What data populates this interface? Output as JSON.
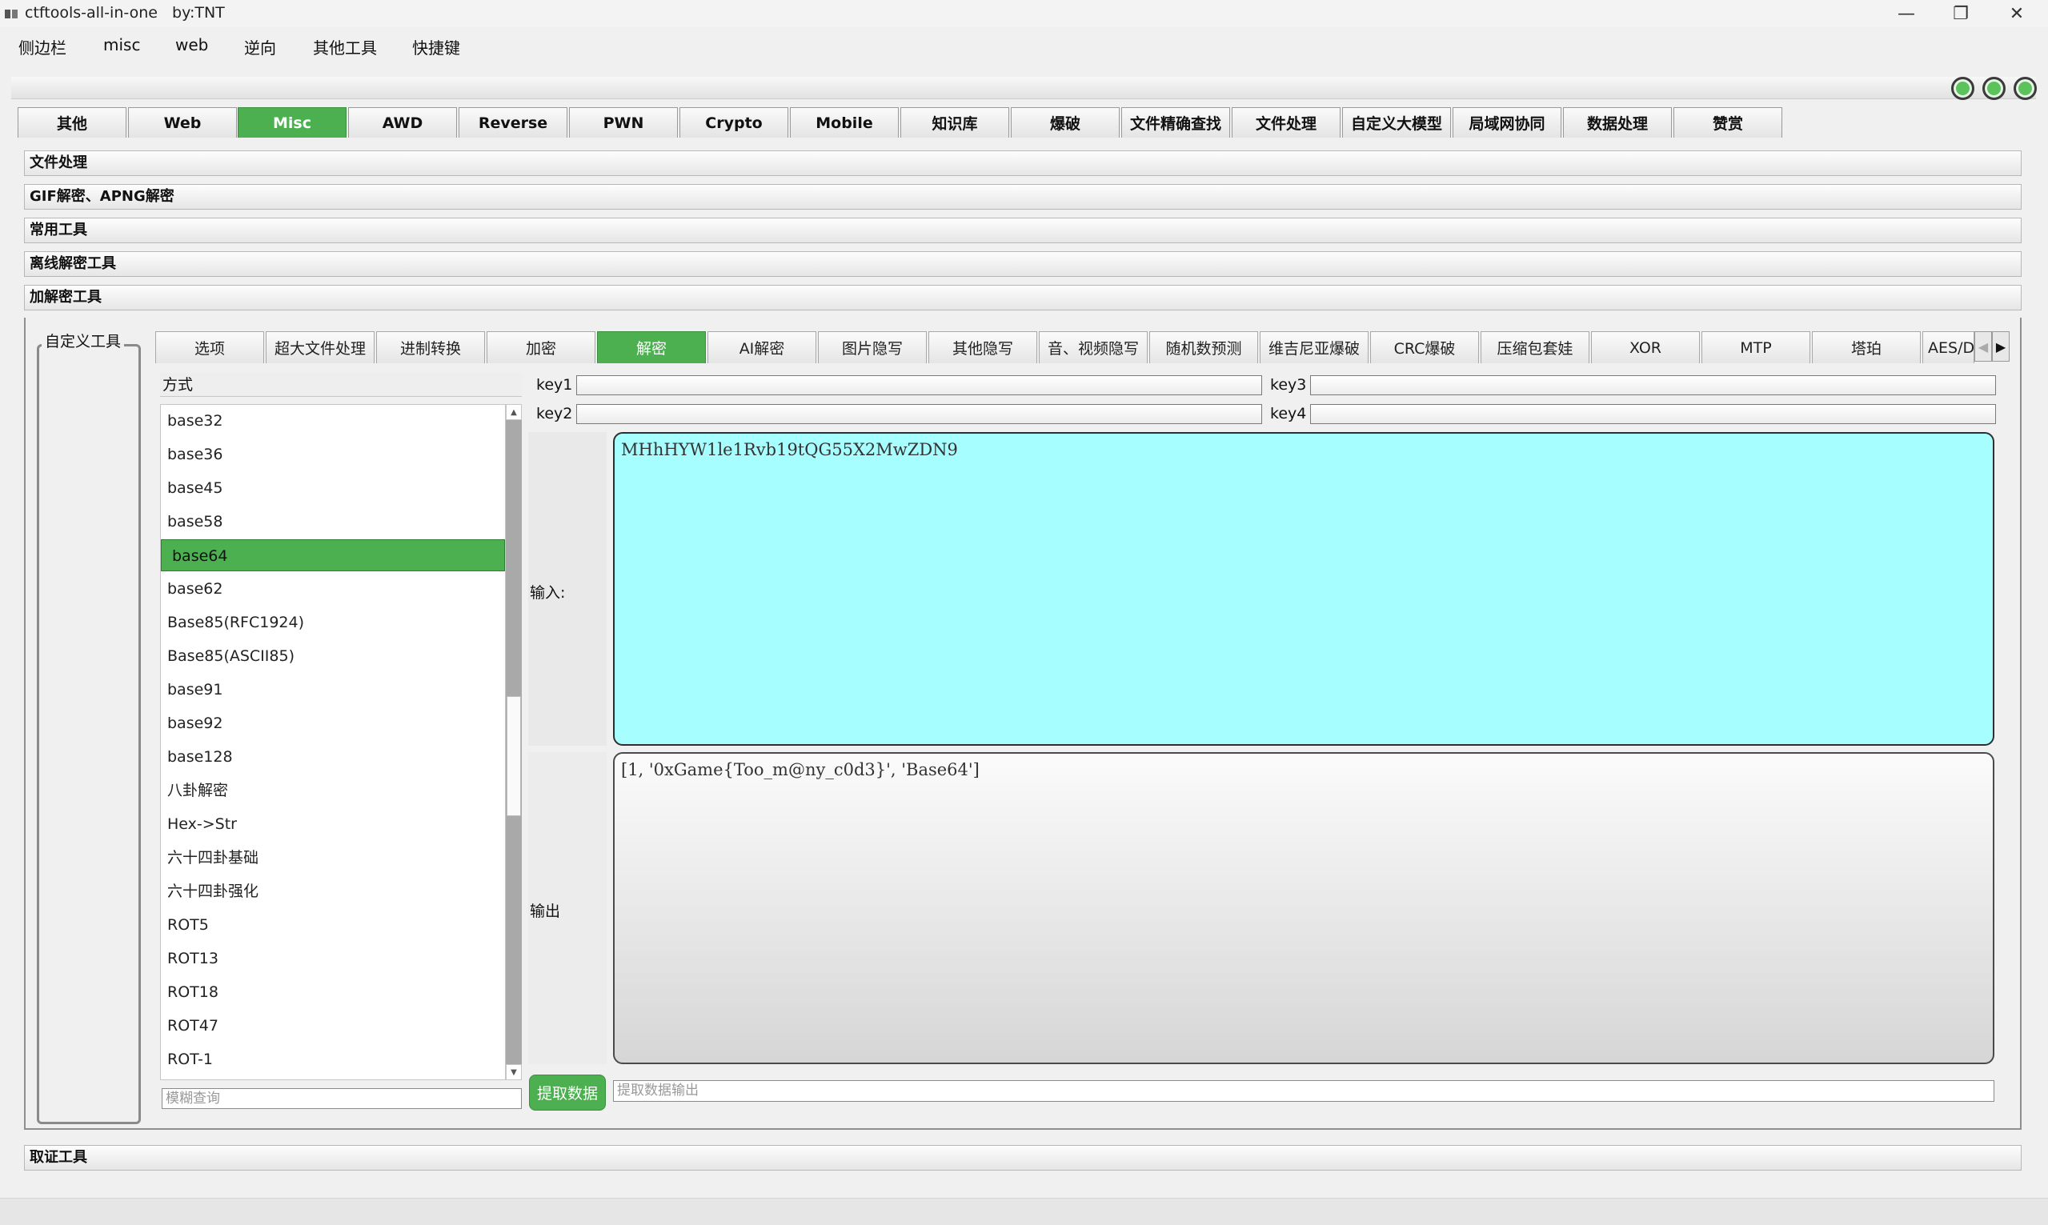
{
  "window": {
    "title": "ctftools-all-in-one   by:TNT",
    "minimize_glyph": "—",
    "restore_glyph": "❐",
    "close_glyph": "✕"
  },
  "menu": [
    "侧边栏",
    "misc",
    "web",
    "逆向",
    "其他工具",
    "快捷键"
  ],
  "main_tabs": [
    "其他",
    "Web",
    "Misc",
    "AWD",
    "Reverse",
    "PWN",
    "Crypto",
    "Mobile",
    "知识库",
    "爆破",
    "文件精确查找",
    "文件处理",
    "自定义大模型",
    "局域网协同",
    "数据处理",
    "赞赏"
  ],
  "main_tab_active": "Misc",
  "sections": [
    "文件处理",
    "GIF解密、APNG解密",
    "常用工具",
    "离线解密工具",
    "加解密工具"
  ],
  "sidebar_label": "自定义工具",
  "sub_tabs": [
    "选项",
    "超大文件处理",
    "进制转换",
    "加密",
    "解密",
    "AI解密",
    "图片隐写",
    "其他隐写",
    "音、视频隐写",
    "随机数预测",
    "维吉尼亚爆破",
    "CRC爆破",
    "压缩包套娃",
    "XOR",
    "MTP",
    "塔珀",
    "AES/D"
  ],
  "sub_tab_active": "解密",
  "method_header": "方式",
  "methods": [
    "base32",
    "base36",
    "base45",
    "base58",
    "base64",
    "base62",
    "Base85(RFC1924)",
    "Base85(ASCII85)",
    "base91",
    "base92",
    "base128",
    "八卦解密",
    "Hex->Str",
    "六十四卦基础",
    "六十四卦强化",
    "ROT5",
    "ROT13",
    "ROT18",
    "ROT47",
    "ROT-1"
  ],
  "method_selected": "base64",
  "search_placeholder": "模糊查询",
  "keys": {
    "key1": "key1",
    "key2": "key2",
    "key3": "key3",
    "key4": "key4"
  },
  "io": {
    "input_label": "输入:",
    "input_value": "MHhHYW1le1Rvb19tQG55X2MwZDN9",
    "output_label": "输出",
    "output_value": "[1, '0xGame{Too_m@ny_c0d3}', 'Base64']"
  },
  "extract_button": "提取数据",
  "extract_placeholder": "提取数据输出",
  "bottom_section": "取证工具",
  "colors": {
    "accent": "#4caf50",
    "input_bg": "#a7feff"
  }
}
